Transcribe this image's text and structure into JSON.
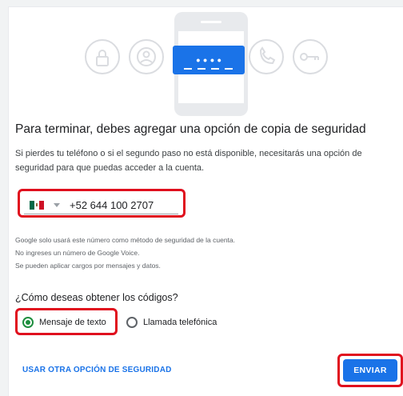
{
  "title": "Para terminar, debes agregar una opción de copia de seguridad",
  "description": "Si pierdes tu teléfono o si el segundo paso no está disponible, necesitarás una opción de seguridad para que puedas acceder a la cuenta.",
  "phone": {
    "country": "Mexico",
    "value": "+52 644 100 2707"
  },
  "notes": [
    "Google solo usará este número como método de seguridad de la cuenta.",
    "No ingreses un número de Google Voice.",
    "Se pueden aplicar cargos por mensajes y datos."
  ],
  "question": "¿Cómo deseas obtener los códigos?",
  "options": {
    "sms": {
      "label": "Mensaje de texto",
      "selected": true
    },
    "call": {
      "label": "Llamada telefónica",
      "selected": false
    }
  },
  "code_dots": "• • • •",
  "actions": {
    "other_option": "USAR OTRA OPCIÓN DE SEGURIDAD",
    "send": "ENVIAR"
  },
  "colors": {
    "accent": "#1a73e8",
    "radio_selected": "#1e8e3e",
    "highlight": "#e0101e"
  }
}
